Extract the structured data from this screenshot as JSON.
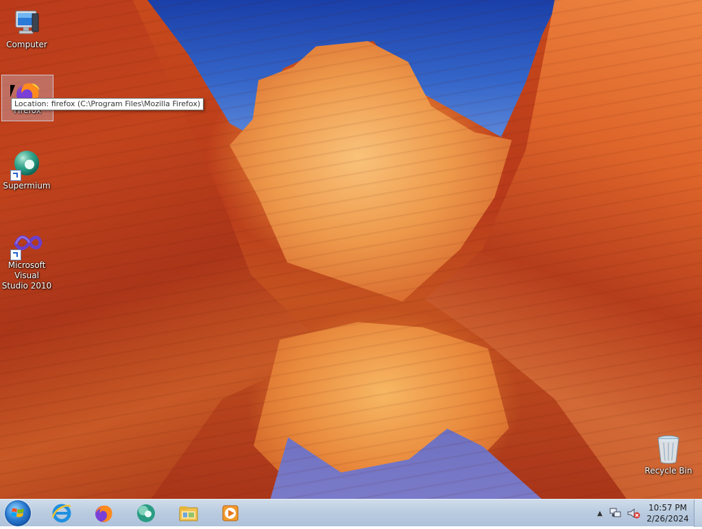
{
  "desktop_icons": [
    {
      "label": "Computer"
    },
    {
      "label": "Firefox"
    },
    {
      "label": "Supermium"
    },
    {
      "label": "Microsoft Visual Studio 2010"
    },
    {
      "label": "Recycle Bin"
    }
  ],
  "tooltip": "Location: firefox (C:\\Program Files\\Mozilla Firefox)",
  "taskbar": {
    "pinned": [
      {
        "icon": "internet-explorer-icon"
      },
      {
        "icon": "firefox-icon"
      },
      {
        "icon": "supermium-icon"
      },
      {
        "icon": "file-explorer-icon"
      },
      {
        "icon": "media-player-icon"
      }
    ],
    "tray": {
      "time": "10:57 PM",
      "date": "2/26/2024"
    }
  },
  "colors": {
    "taskbar": "#b9cbe0",
    "sky": "#1a3fa8",
    "rock": "#c84a1c"
  }
}
